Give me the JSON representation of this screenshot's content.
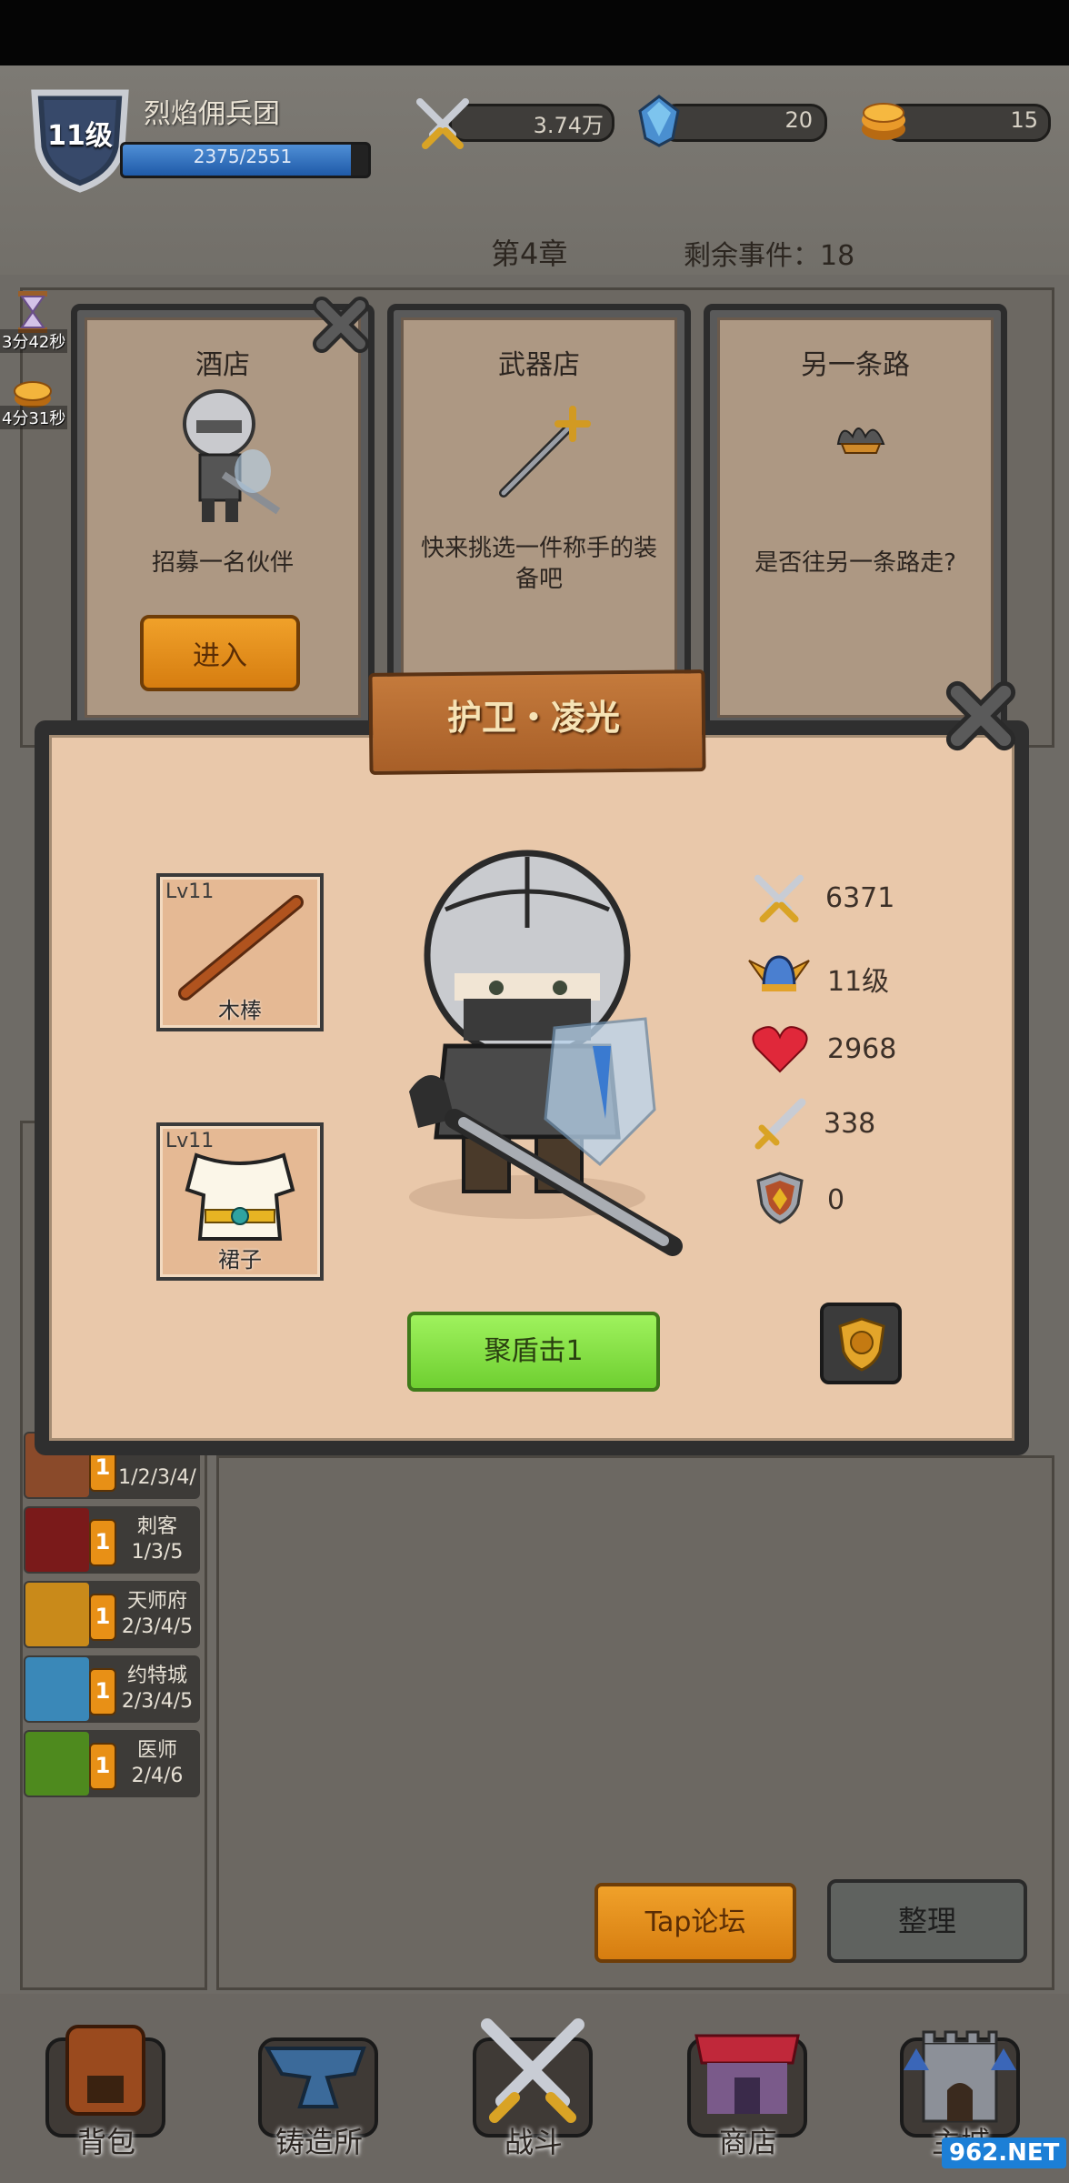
{
  "header": {
    "level": "11级",
    "team_name": "烈焰佣兵团",
    "xp_text": "2375/2551",
    "xp_progress": 0.93,
    "power": "3.74万",
    "gems": "20",
    "coins": "15",
    "chapter": "第4章",
    "remaining_events": "剩余事件：18"
  },
  "timers": [
    {
      "text": "3分42秒",
      "icon": "hourglass-icon"
    },
    {
      "text": "4分31秒",
      "icon": "coin-icon"
    }
  ],
  "cards": [
    {
      "title": "酒店",
      "desc": "招募一名伙伴",
      "button": "进入",
      "icon": "knight-icon"
    },
    {
      "title": "武器店",
      "desc": "快来挑选一件称手的装备吧",
      "icon": "staff-icon"
    },
    {
      "title": "另一条路",
      "desc": "是否往另一条路走?",
      "icon": "path-icon"
    }
  ],
  "popup": {
    "title": "护卫・凌光",
    "weapon": {
      "level": "Lv11",
      "name": "木棒"
    },
    "armor": {
      "level": "Lv11",
      "name": "裙子"
    },
    "stats": [
      {
        "icon": "crossed-swords-icon",
        "value": "6371"
      },
      {
        "icon": "winged-helmet-icon",
        "value": "11级"
      },
      {
        "icon": "heart-icon",
        "value": "2968"
      },
      {
        "icon": "sword-icon",
        "value": "338"
      },
      {
        "icon": "shield-icon",
        "value": "0"
      }
    ],
    "skill": "聚盾击1"
  },
  "factions": [
    {
      "badge": "1",
      "name": "",
      "sub": "1/2/3/4/",
      "color": "#8a4a2a"
    },
    {
      "badge": "1",
      "name": "刺客",
      "sub": "1/3/5",
      "color": "#7a1a1a"
    },
    {
      "badge": "1",
      "name": "天师府",
      "sub": "2/3/4/5",
      "color": "#c98a1a"
    },
    {
      "badge": "1",
      "name": "约特城",
      "sub": "2/3/4/5",
      "color": "#3a88b8"
    },
    {
      "badge": "1",
      "name": "医师",
      "sub": "2/4/6",
      "color": "#4e8a1e"
    }
  ],
  "buttons": {
    "tap_forum": "Tap论坛",
    "sort": "整理"
  },
  "nav": [
    {
      "label": "背包",
      "icon": "backpack-icon"
    },
    {
      "label": "铸造所",
      "icon": "anvil-icon"
    },
    {
      "label": "战斗",
      "icon": "battle-icon"
    },
    {
      "label": "商店",
      "icon": "shop-icon"
    },
    {
      "label": "主城",
      "icon": "castle-icon"
    }
  ],
  "watermark": "962.NET"
}
